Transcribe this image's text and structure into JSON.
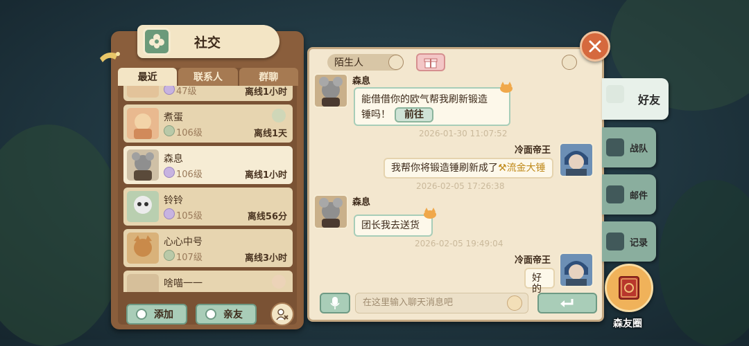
{
  "title": "社交",
  "tabs": [
    {
      "label": "最近",
      "active": true
    },
    {
      "label": "联系人",
      "active": false
    },
    {
      "label": "群聊",
      "active": false
    }
  ],
  "friends": [
    {
      "name": "",
      "level": "47级",
      "status": "离线1小时"
    },
    {
      "name": "煮蛋",
      "level": "106级",
      "status": "离线1天"
    },
    {
      "name": "森息",
      "level": "106级",
      "status": "离线1小时"
    },
    {
      "name": "铃铃",
      "level": "105级",
      "status": "离线56分"
    },
    {
      "name": "心心中号",
      "level": "107级",
      "status": "离线3小时"
    },
    {
      "name": "啥喵一一",
      "level": "",
      "status": ""
    }
  ],
  "buttons": {
    "add": "添加",
    "close_friends": "亲友"
  },
  "chat": {
    "header_label": "陌生人",
    "input_placeholder": "在这里输入聊天消息吧",
    "messages": [
      {
        "sender": "森息",
        "text_line1": "能借借你的欧气帮我刷新锻造",
        "text_line2": "锤吗！",
        "button": "前往",
        "time": "2026-01-30 11:07:52",
        "side": "left"
      },
      {
        "sender": "冷面帝王",
        "text": "我帮你将锻造锤刷新成了",
        "item": "流金大锤",
        "time": "2026-02-05 17:26:38",
        "side": "right"
      },
      {
        "sender": "森息",
        "text": "团长我去送货",
        "time": "2026-02-05 19:49:04",
        "side": "left"
      },
      {
        "sender": "冷面帝王",
        "text": "好的",
        "side": "right"
      }
    ]
  },
  "side_tabs": [
    {
      "label": "好友",
      "active": true,
      "icon": "friends-icon"
    },
    {
      "label": "战队",
      "active": false,
      "icon": "team-icon"
    },
    {
      "label": "邮件",
      "active": false,
      "icon": "mail-icon"
    },
    {
      "label": "记录",
      "active": false,
      "icon": "record-icon"
    }
  ],
  "forest_circle_label": "森友圈",
  "colors": {
    "panel_brown": "#8a5e3c",
    "parchment": "#f3e7cf",
    "accent_green": "#a9cdb8",
    "close_orange": "#d5693e",
    "item_gold": "#c08a1a"
  }
}
